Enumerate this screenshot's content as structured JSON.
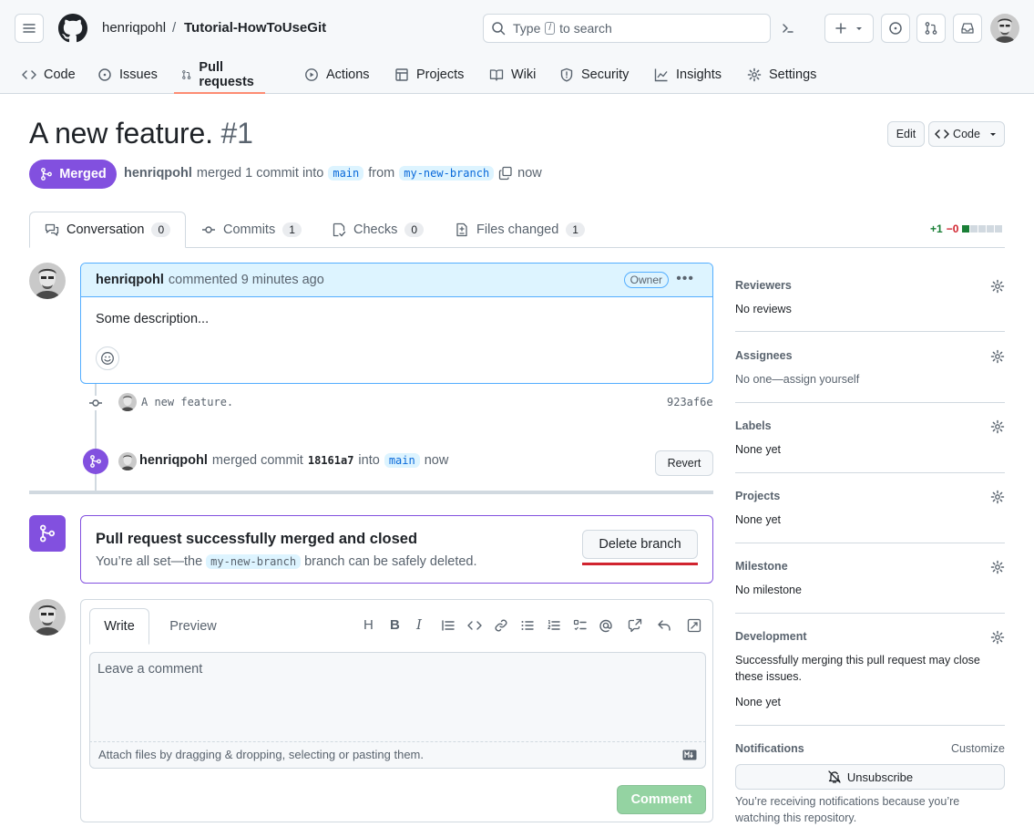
{
  "header": {
    "owner": "henriqpohl",
    "separator": "/",
    "repo": "Tutorial-HowToUseGit",
    "search_prefix": "Type",
    "search_key": "/",
    "search_suffix": "to search"
  },
  "nav": [
    {
      "label": "Code",
      "icon": "code-icon"
    },
    {
      "label": "Issues",
      "icon": "issue-icon"
    },
    {
      "label": "Pull requests",
      "icon": "pull-request-icon"
    },
    {
      "label": "Actions",
      "icon": "play-icon"
    },
    {
      "label": "Projects",
      "icon": "table-icon"
    },
    {
      "label": "Wiki",
      "icon": "book-icon"
    },
    {
      "label": "Security",
      "icon": "shield-icon"
    },
    {
      "label": "Insights",
      "icon": "graph-icon"
    },
    {
      "label": "Settings",
      "icon": "gear-icon"
    }
  ],
  "pr": {
    "title": "A new feature.",
    "number": "#1",
    "edit_label": "Edit",
    "code_label": "Code",
    "state": "Merged",
    "author": "henriqpohl",
    "meta_text": "merged 1 commit into",
    "base": "main",
    "from_text": "from",
    "head": "my-new-branch",
    "time": "now"
  },
  "tabs": [
    {
      "label": "Conversation",
      "count": "0"
    },
    {
      "label": "Commits",
      "count": "1"
    },
    {
      "label": "Checks",
      "count": "0"
    },
    {
      "label": "Files changed",
      "count": "1"
    }
  ],
  "diffstat": {
    "added": "+1",
    "removed": "−0"
  },
  "comment": {
    "author": "henriqpohl",
    "action": "commented 9 minutes ago",
    "badge": "Owner",
    "body": "Some description..."
  },
  "commit": {
    "message": "A new feature.",
    "sha": "923af6e"
  },
  "merge_event": {
    "author": "henriqpohl",
    "text1": "merged commit",
    "sha": "18161a7",
    "text2": "into",
    "branch": "main",
    "time": "now",
    "revert_label": "Revert"
  },
  "merged_box": {
    "title": "Pull request successfully merged and closed",
    "sub1": "You’re all set—the",
    "branch": "my-new-branch",
    "sub2": "branch can be safely deleted.",
    "delete_label": "Delete branch"
  },
  "write": {
    "tab_write": "Write",
    "tab_preview": "Preview",
    "placeholder": "Leave a comment",
    "attach": "Attach files by dragging & dropping, selecting or pasting them.",
    "submit": "Comment"
  },
  "sidebar": {
    "reviewers": {
      "title": "Reviewers",
      "value": "No reviews"
    },
    "assignees": {
      "title": "Assignees",
      "value": "No one—assign yourself"
    },
    "labels": {
      "title": "Labels",
      "value": "None yet"
    },
    "projects": {
      "title": "Projects",
      "value": "None yet"
    },
    "milestone": {
      "title": "Milestone",
      "value": "No milestone"
    },
    "development": {
      "title": "Development",
      "line1": "Successfully merging this pull request may close",
      "line2": "these issues.",
      "value": "None yet"
    },
    "notifications": {
      "title": "Notifications",
      "customize": "Customize",
      "button": "Unsubscribe",
      "line1": "You’re receiving notifications because you’re",
      "line2": "watching this repository."
    }
  },
  "colors": {
    "merged": "#8250df",
    "accent": "#0969da",
    "added": "#1a7f37",
    "removed": "#d1242f",
    "tab_underline": "#fd8c73"
  }
}
